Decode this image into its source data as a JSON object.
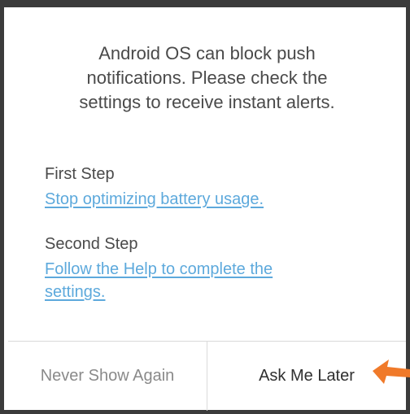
{
  "dialog": {
    "message": "Android OS can block push\nnotifications. Please check the\nsettings to receive instant alerts.",
    "steps": [
      {
        "title": "First Step",
        "link": "Stop optimizing battery usage."
      },
      {
        "title": "Second Step",
        "link": "Follow the Help to complete the\nsettings."
      }
    ]
  },
  "footer": {
    "never_label": "Never Show Again",
    "later_label": "Ask Me Later"
  },
  "colors": {
    "link": "#5da9dc",
    "annotation_arrow": "#f07a2a",
    "frame": "#3b3b3b"
  },
  "annotation": {
    "icon": "orange-arrow-icon"
  }
}
